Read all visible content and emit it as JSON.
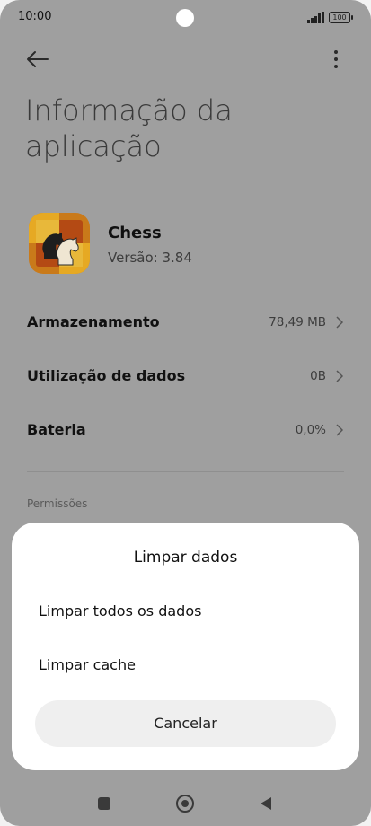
{
  "status": {
    "time": "10:00",
    "battery": "100"
  },
  "header": {
    "title": "Informação da aplicação"
  },
  "app": {
    "name": "Chess",
    "version": "Versão: 3.84"
  },
  "rows": [
    {
      "label": "Armazenamento",
      "value": "78,49 MB"
    },
    {
      "label": "Utilização de dados",
      "value": "0B"
    },
    {
      "label": "Bateria",
      "value": "0,0%"
    }
  ],
  "section": {
    "permissions": "Permissões"
  },
  "sheet": {
    "title": "Limpar dados",
    "options": [
      "Limpar todos os dados",
      "Limpar cache"
    ],
    "cancel": "Cancelar"
  },
  "icons": {
    "back": "arrow-left-icon",
    "more": "more-vertical-icon",
    "chevron": "chevron-right-icon",
    "nav_recent": "recents-square-icon",
    "nav_home": "home-circle-icon",
    "nav_back": "back-triangle-icon"
  },
  "colors": {
    "scrim": "#9f9f9f",
    "sheet": "#ffffff",
    "cancel_bg": "#efefef"
  }
}
